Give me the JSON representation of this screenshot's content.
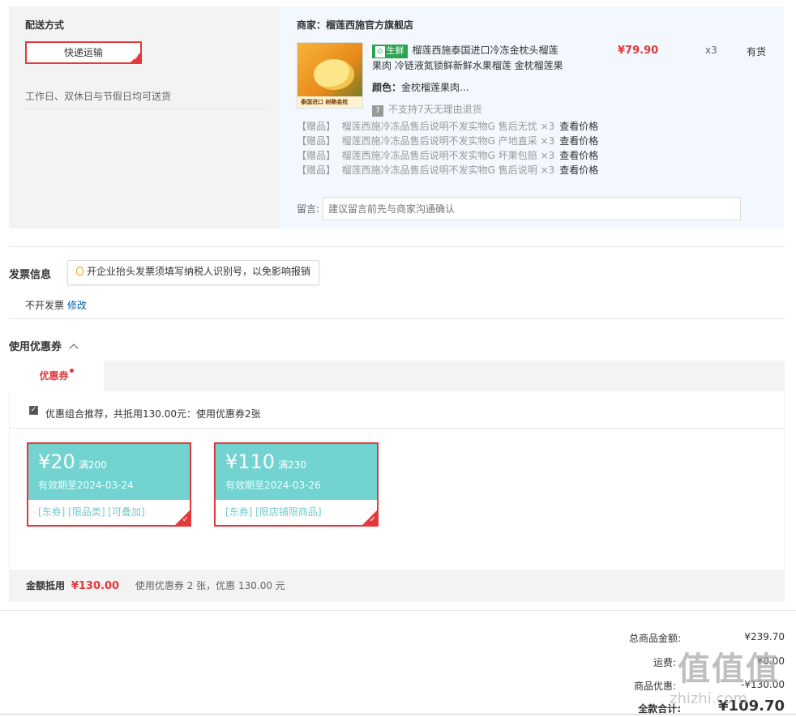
{
  "delivery": {
    "title": "配送方式",
    "method": "快递运输",
    "note": "工作日、双休日与节假日均可送货"
  },
  "shop": {
    "label": "商家：",
    "name": "榴莲西施官方旗舰店",
    "product": {
      "tag": "生鲜",
      "title_line1": "榴莲西施泰国进口冷冻金枕头榴莲",
      "title_line2": "果肉 冷链液氮锁鲜新鲜水果榴莲 金枕榴莲果",
      "price": "¥79.90",
      "qty": "x3",
      "stock": "有货",
      "color_label": "颜色：",
      "color_value": "金枕榴莲果肉...",
      "return_badge": "7",
      "return_note": "不支持7天无理由退货",
      "thumb_text": "泰国进口 树熟金枕"
    },
    "gifts": [
      {
        "tag": "【赠品】",
        "text": "榴莲西施冷冻品售后说明不发实物G 售后无忧 ×3",
        "link": "查看价格"
      },
      {
        "tag": "【赠品】",
        "text": "榴莲西施冷冻品售后说明不发实物G 产地直采 ×3",
        "link": "查看价格"
      },
      {
        "tag": "【赠品】",
        "text": "榴莲西施冷冻品售后说明不发实物G 坏果包赔 ×3",
        "link": "查看价格"
      },
      {
        "tag": "【赠品】",
        "text": "榴莲西施冷冻品售后说明不发实物G 售后说明 ×3",
        "link": "查看价格"
      }
    ],
    "note_label": "留言:",
    "note_placeholder": "建议留言前先与商家沟通确认"
  },
  "invoice": {
    "title": "发票信息",
    "tip": "开企业抬头发票须填写纳税人识别号，以免影响报销",
    "status": "不开发票",
    "edit": "修改"
  },
  "coupons": {
    "title": "使用优惠券",
    "tab": "优惠券",
    "recommend": "优惠组合推荐，共抵用130.00元：使用优惠券2张",
    "items": [
      {
        "amount": "¥20",
        "cond": "满200",
        "valid": "有效期至2024-03-24",
        "tags": "[东券]  [限品类]  [可叠加]"
      },
      {
        "amount": "¥110",
        "cond": "满230",
        "valid": "有效期至2024-03-26",
        "tags": "[东券]  [限店铺限商品]"
      }
    ],
    "sum_label": "金额抵用",
    "sum_value": "¥130.00",
    "sum_detail": "使用优惠券 2 张，优惠 130.00 元"
  },
  "totals": {
    "goods_label": "总商品金额:",
    "goods_value": "¥239.70",
    "shipping_label": "运费:",
    "shipping_value": "¥0.00",
    "discount_label": "商品优惠:",
    "discount_value": "-¥130.00",
    "total_label": "全款合计:",
    "total_value": "¥109.70"
  },
  "watermark": {
    "glyphs": "值值值",
    "site": "zhizhi.com"
  },
  "colors": {
    "accent": "#e4393c",
    "coupon": "#73d3d1",
    "link": "#005ea7",
    "fresh": "#2ca34f"
  }
}
